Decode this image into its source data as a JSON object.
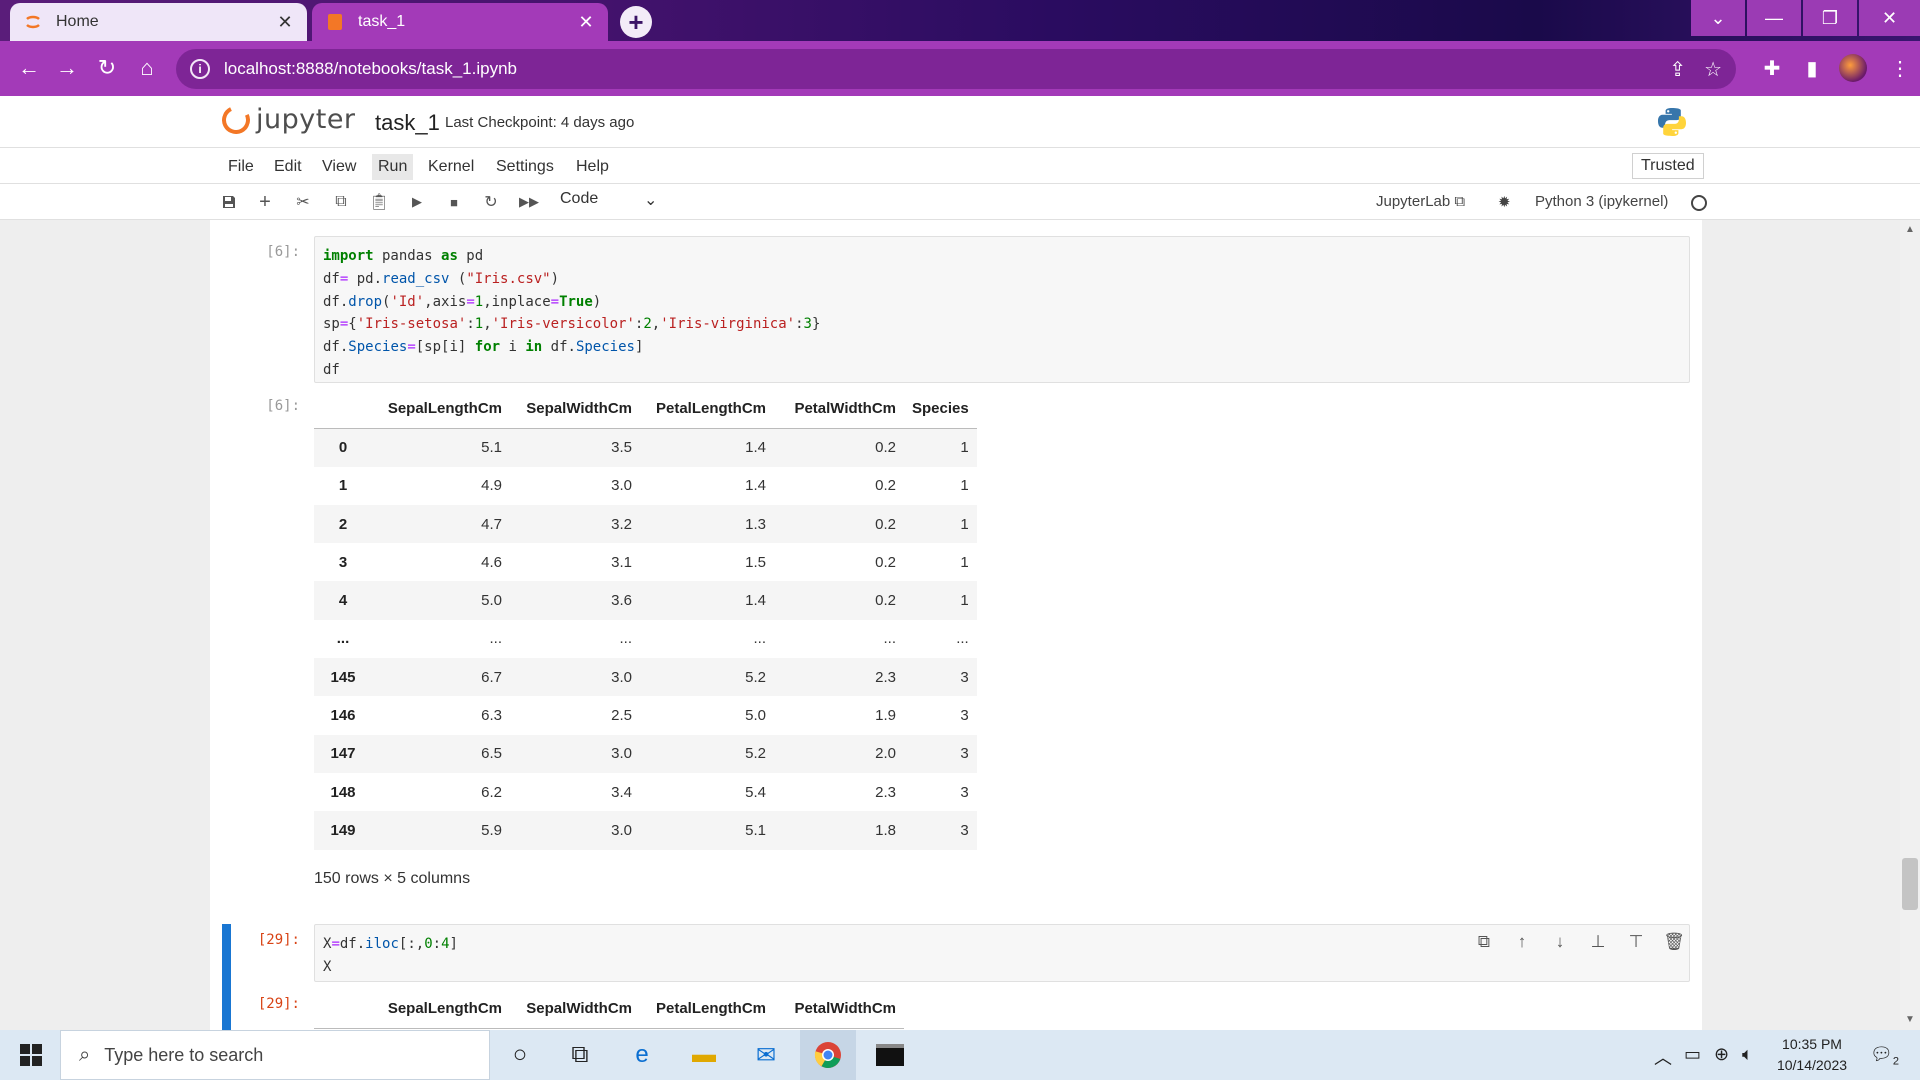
{
  "browser": {
    "tabs": [
      {
        "label": "Home",
        "active": false
      },
      {
        "label": "task_1",
        "active": true
      }
    ],
    "new_tab": "+",
    "url": "localhost:8888/notebooks/task_1.ipynb",
    "window_controls": [
      "chevron-down-icon",
      "minimize-icon",
      "restore-icon",
      "close-icon"
    ],
    "accent": "#a33ab8"
  },
  "jupyter": {
    "logo_text": "jupyter",
    "notebook_name": "task_1",
    "checkpoint": "Last Checkpoint: 4 days ago",
    "menu": [
      "File",
      "Edit",
      "View",
      "Run",
      "Kernel",
      "Settings",
      "Help"
    ],
    "active_menu": "Run",
    "trusted": "Trusted",
    "cell_type": "Code",
    "jupyterlab_link": "JupyterLab",
    "kernel": "Python 3 (ipykernel)"
  },
  "cells": [
    {
      "prompt": "[6]:",
      "code": [
        "import pandas as pd",
        "df= pd.read_csv (\"Iris.csv\")",
        "df.drop('Id',axis=1,inplace=True)",
        "sp={'Iris-setosa':1,'Iris-versicolor':2,'Iris-virginica':3}",
        "df.Species=[sp[i] for i in df.Species]",
        "df"
      ],
      "output_prompt": "[6]:",
      "table": {
        "columns": [
          "",
          "SepalLengthCm",
          "SepalWidthCm",
          "PetalLengthCm",
          "PetalWidthCm",
          "Species"
        ],
        "rows": [
          [
            "0",
            "5.1",
            "3.5",
            "1.4",
            "0.2",
            "1"
          ],
          [
            "1",
            "4.9",
            "3.0",
            "1.4",
            "0.2",
            "1"
          ],
          [
            "2",
            "4.7",
            "3.2",
            "1.3",
            "0.2",
            "1"
          ],
          [
            "3",
            "4.6",
            "3.1",
            "1.5",
            "0.2",
            "1"
          ],
          [
            "4",
            "5.0",
            "3.6",
            "1.4",
            "0.2",
            "1"
          ],
          [
            "...",
            "...",
            "...",
            "...",
            "...",
            "..."
          ],
          [
            "145",
            "6.7",
            "3.0",
            "5.2",
            "2.3",
            "3"
          ],
          [
            "146",
            "6.3",
            "2.5",
            "5.0",
            "1.9",
            "3"
          ],
          [
            "147",
            "6.5",
            "3.0",
            "5.2",
            "2.0",
            "3"
          ],
          [
            "148",
            "6.2",
            "3.4",
            "5.4",
            "2.3",
            "3"
          ],
          [
            "149",
            "5.9",
            "3.0",
            "5.1",
            "1.8",
            "3"
          ]
        ]
      },
      "shape": "150 rows × 5 columns"
    },
    {
      "prompt": "[29]:",
      "code": [
        "X=df.iloc[:,0:4]",
        "X"
      ],
      "output_prompt": "[29]:",
      "table": {
        "columns": [
          "",
          "SepalLengthCm",
          "SepalWidthCm",
          "PetalLengthCm",
          "PetalWidthCm"
        ]
      }
    }
  ],
  "taskbar": {
    "search_placeholder": "Type here to search",
    "time": "10:35 PM",
    "date": "10/14/2023",
    "notifications": "2"
  }
}
